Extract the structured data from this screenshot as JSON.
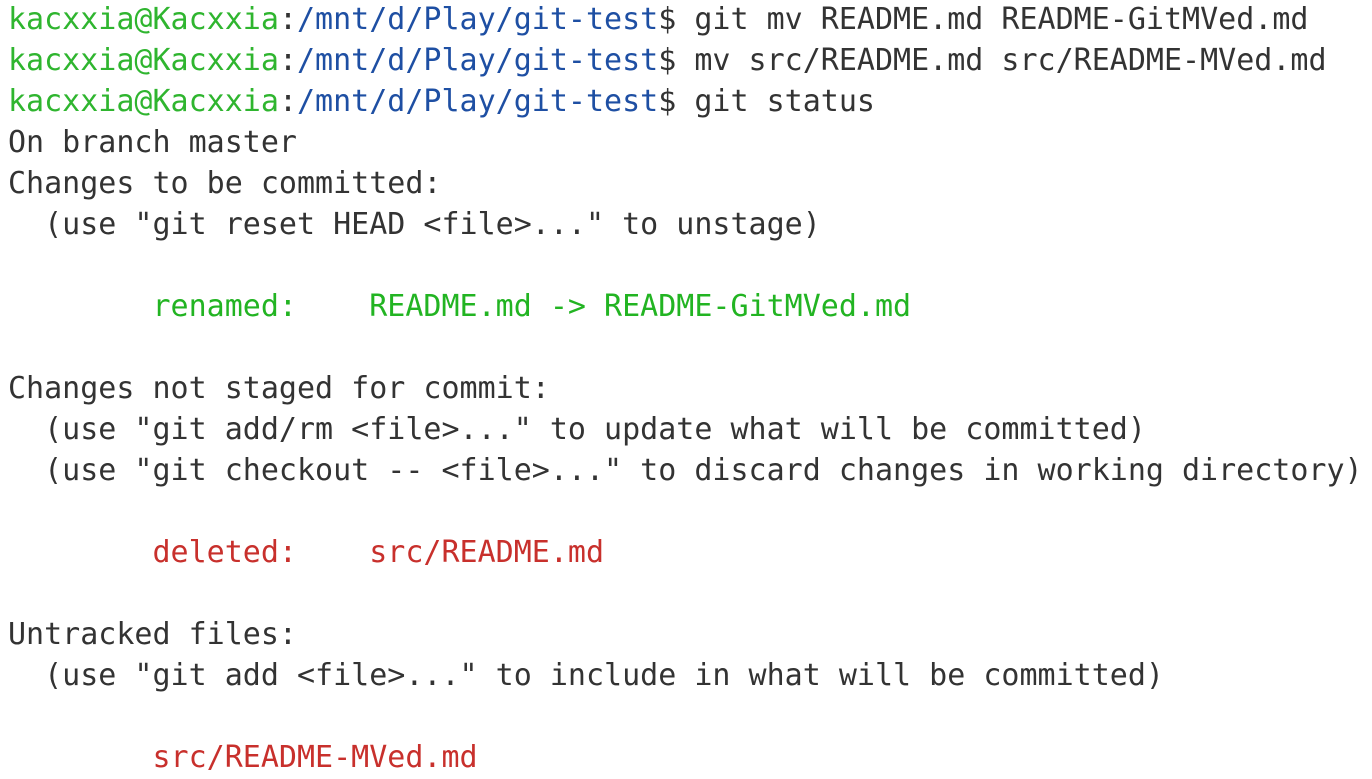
{
  "prompt": {
    "user_host": "kacxxia@Kacxxia",
    "separator": ":",
    "cwd": "/mnt/d/Play/git-test",
    "symbol": "$ "
  },
  "commands": [
    "git mv README.md README-GitMVed.md",
    "mv src/README.md src/README-MVed.md",
    "git status"
  ],
  "output": {
    "branch_line": "On branch master",
    "staged": {
      "header": "Changes to be committed:",
      "hint": "  (use \"git reset HEAD <file>...\" to unstage)",
      "entry_status": "        renamed:    ",
      "entry_path": "README.md -> README-GitMVed.md"
    },
    "not_staged": {
      "header": "Changes not staged for commit:",
      "hint1": "  (use \"git add/rm <file>...\" to update what will be committed)",
      "hint2": "  (use \"git checkout -- <file>...\" to discard changes in working directory)",
      "entry_status": "        deleted:    ",
      "entry_path": "src/README.md"
    },
    "untracked": {
      "header": "Untracked files:",
      "hint": "  (use \"git add <file>...\" to include in what will be committed)",
      "entry_indent": "        ",
      "entry_path": "src/README-MVed.md"
    }
  },
  "colors": {
    "user_host": "#2fb52f",
    "cwd": "#1e4fa3",
    "text": "#333333",
    "staged": "#22b422",
    "unstaged": "#c8302c",
    "background": "#ffffff"
  }
}
